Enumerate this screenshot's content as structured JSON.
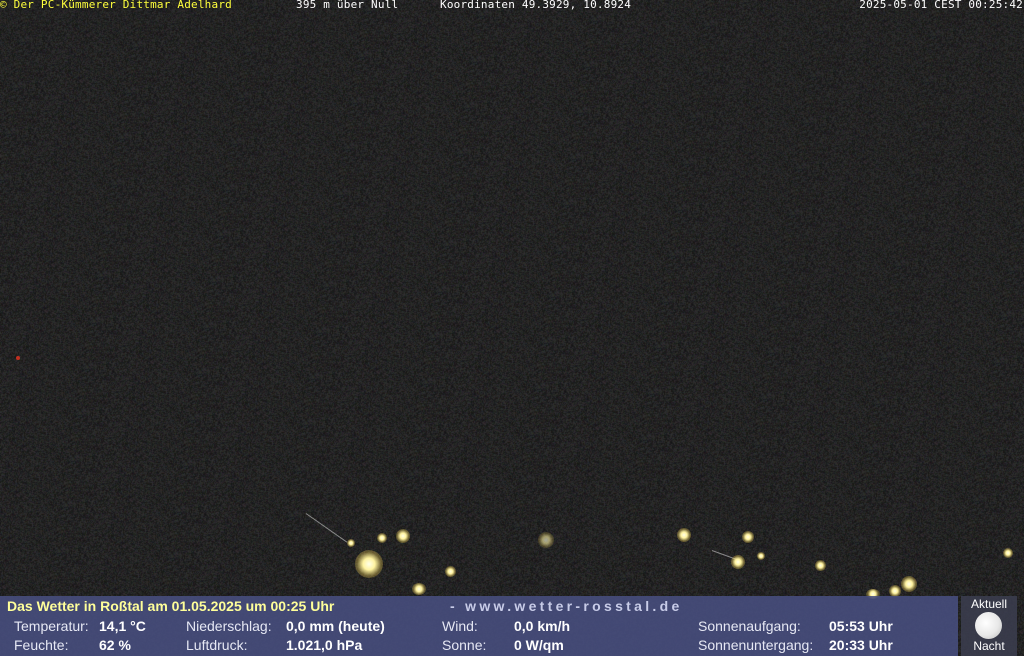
{
  "overlay": {
    "credit": "© Der PC-Kümmerer Dittmar Adelhard",
    "altitude": "395 m über Null",
    "coordinates": "Koordinaten 49.3929, 10.8924",
    "timestamp": "2025-05-01 CEST 00:25:42"
  },
  "weather": {
    "title": "Das Wetter in Roßtal am 01.05.2025 um 00:25 Uhr",
    "website": "- www.wetter-rosstal.de",
    "temperature_label": "Temperatur:",
    "temperature_value": "14,1 °C",
    "humidity_label": "Feuchte:",
    "humidity_value": "62 %",
    "precipitation_label": "Niederschlag:",
    "precipitation_value": "0,0 mm (heute)",
    "pressure_label": "Luftdruck:",
    "pressure_value": "1.021,0 hPa",
    "wind_label": "Wind:",
    "wind_value": "0,0 km/h",
    "sun_label": "Sonne:",
    "sun_value": "0 W/qm",
    "sunrise_label": "Sonnenaufgang:",
    "sunrise_value": "05:53 Uhr",
    "sunset_label": "Sonnenuntergang:",
    "sunset_value": "20:33 Uhr"
  },
  "moon": {
    "current_label": "Aktuell",
    "phase_label": "Nacht"
  }
}
